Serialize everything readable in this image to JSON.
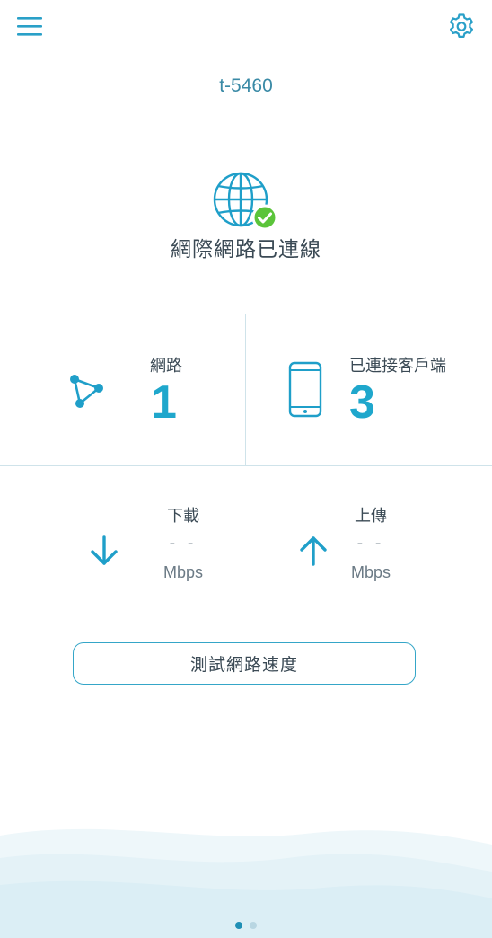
{
  "header": {
    "menu_icon": "hamburger-menu-icon",
    "settings_icon": "gear-icon"
  },
  "device": {
    "name": "t-5460"
  },
  "status": {
    "icon": "globe-check-icon",
    "text": "網際網路已連線"
  },
  "stats": {
    "networks": {
      "label": "網路",
      "value": "1",
      "icon": "network-topology-icon"
    },
    "clients": {
      "label": "已連接客戶端",
      "value": "3",
      "icon": "smartphone-icon"
    }
  },
  "speed": {
    "download": {
      "label": "下載",
      "value": "- -",
      "unit": "Mbps",
      "icon": "arrow-down-icon"
    },
    "upload": {
      "label": "上傳",
      "value": "- -",
      "unit": "Mbps",
      "icon": "arrow-up-icon"
    }
  },
  "actions": {
    "speed_test_label": "測試網路速度"
  },
  "pager": {
    "total": 2,
    "active": 1
  },
  "colors": {
    "accent": "#1fa7cc",
    "check": "#5bc43a",
    "divider": "#cfe3ea",
    "text": "#3b4a55",
    "muted": "#6b7a85"
  }
}
